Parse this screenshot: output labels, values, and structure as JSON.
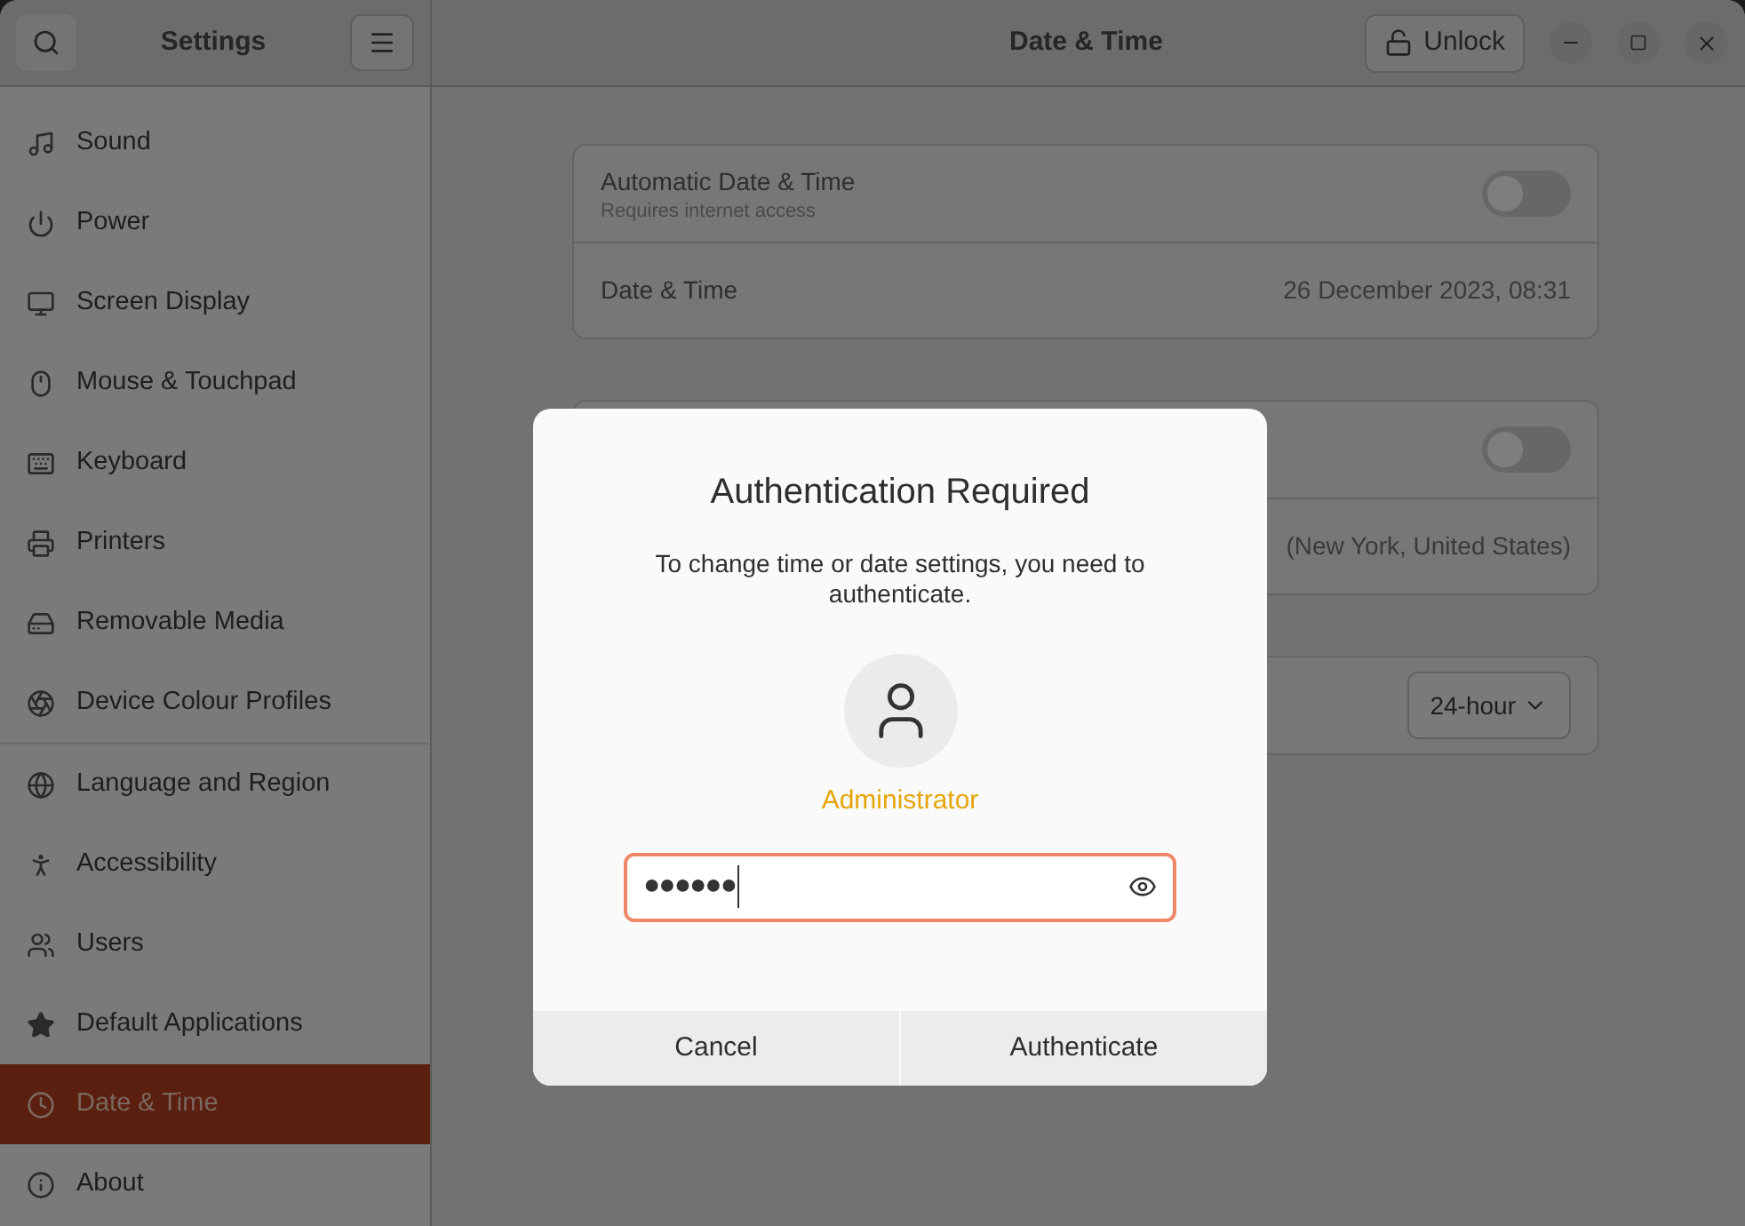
{
  "sidebar": {
    "title": "Settings",
    "groups": [
      {
        "items": [
          {
            "label": "Sound",
            "selected": false
          },
          {
            "label": "Power",
            "selected": false
          },
          {
            "label": "Screen Display",
            "selected": false
          },
          {
            "label": "Mouse & Touchpad",
            "selected": false
          },
          {
            "label": "Keyboard",
            "selected": false
          },
          {
            "label": "Printers",
            "selected": false
          },
          {
            "label": "Removable Media",
            "selected": false
          },
          {
            "label": "Device Colour Profiles",
            "selected": false
          }
        ]
      },
      {
        "items": [
          {
            "label": "Language and Region",
            "selected": false
          },
          {
            "label": "Accessibility",
            "selected": false
          },
          {
            "label": "Users",
            "selected": false
          },
          {
            "label": "Default Applications",
            "selected": false
          },
          {
            "label": "Date & Time",
            "selected": true
          },
          {
            "label": "About",
            "selected": false
          }
        ]
      }
    ]
  },
  "header": {
    "title": "Date & Time",
    "unlock_button": "Unlock"
  },
  "cards": [
    {
      "rows": [
        {
          "kind": "toggle",
          "label": "Automatic Date & Time",
          "subtitle": "Requires internet access",
          "on": false
        },
        {
          "kind": "value",
          "label": "Date & Time",
          "value": "26 December 2023, 08:31"
        }
      ]
    },
    {
      "rows": [
        {
          "kind": "toggle",
          "on": false
        },
        {
          "kind": "value",
          "value": "(New York, United States)"
        }
      ]
    },
    {
      "rows": [
        {
          "kind": "dropdown",
          "value": "24-hour"
        }
      ]
    }
  ],
  "dialog": {
    "title": "Authentication Required",
    "message": "To change time or date settings, you need to authenticate.",
    "user": "Administrator",
    "password": "●●●●●●",
    "buttons": [
      "Cancel",
      "Authenticate"
    ]
  }
}
